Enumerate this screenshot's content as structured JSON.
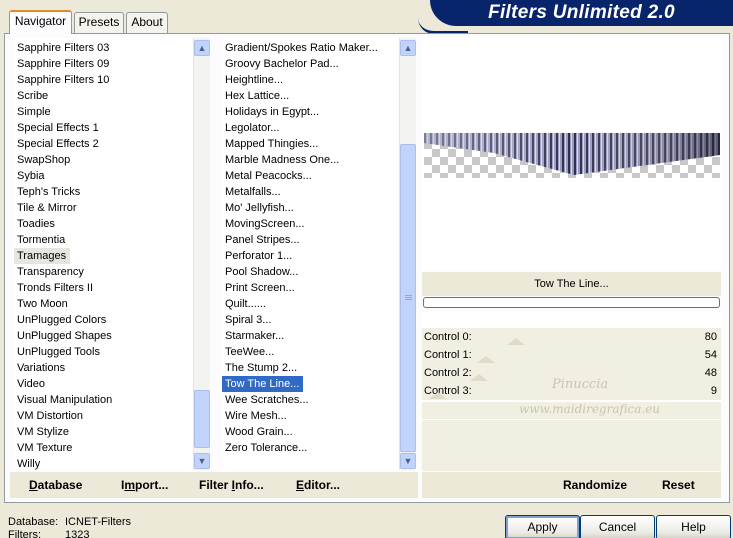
{
  "window": {
    "banner_title": "Filters Unlimited 2.0"
  },
  "tabs": [
    {
      "label": "Navigator",
      "active": true
    },
    {
      "label": "Presets",
      "active": false
    },
    {
      "label": "About",
      "active": false
    }
  ],
  "categories": {
    "items": [
      "Sapphire Filters 03",
      "Sapphire Filters 09",
      "Sapphire Filters 10",
      "Scribe",
      "Simple",
      "Special Effects 1",
      "Special Effects 2",
      "SwapShop",
      "Sybia",
      "Teph's Tricks",
      "Tile & Mirror",
      "Toadies",
      "Tormentia",
      "Tramages",
      "Transparency",
      "Tronds Filters II",
      "Two Moon",
      "UnPlugged Colors",
      "UnPlugged Shapes",
      "UnPlugged Tools",
      "Variations",
      "Video",
      "Visual Manipulation",
      "VM Distortion",
      "VM Stylize",
      "VM Texture",
      "Willy"
    ],
    "selected": "Tramages"
  },
  "filters": {
    "items": [
      "Gradient/Spokes Ratio Maker...",
      "Groovy Bachelor Pad...",
      "Heightline...",
      "Hex Lattice...",
      "Holidays in Egypt...",
      "Legolator...",
      "Mapped Thingies...",
      "Marble Madness One...",
      "Metal Peacocks...",
      "Metalfalls...",
      "Mo' Jellyfish...",
      "MovingScreen...",
      "Panel Stripes...",
      "Perforator 1...",
      "Pool Shadow...",
      "Print Screen...",
      "Quilt......",
      "Spiral 3...",
      "Starmaker...",
      "TeeWee...",
      "The Stump 2...",
      "Tow The Line...",
      "Wee Scratches...",
      "Wire Mesh...",
      "Wood Grain...",
      "Zero Tolerance..."
    ],
    "selected": "Tow The Line..."
  },
  "preview": {
    "filter_name": "Tow The Line..."
  },
  "controls": [
    {
      "label": "Control 0:",
      "value": "80"
    },
    {
      "label": "Control 1:",
      "value": "54"
    },
    {
      "label": "Control 2:",
      "value": "48"
    },
    {
      "label": "Control 3:",
      "value": "9"
    }
  ],
  "watermark": {
    "line1": "Pinuccia",
    "line2": "www.maidiregrafica.eu"
  },
  "toolbar": {
    "database": {
      "u": "D",
      "rest": "atabase"
    },
    "import": {
      "pre": "I",
      "u": "m",
      "rest": "port..."
    },
    "filter_info": {
      "pre": "Filter ",
      "u": "I",
      "rest": "nfo..."
    },
    "editor": {
      "u": "E",
      "rest": "ditor..."
    },
    "randomize": "Randomize",
    "reset": "Reset"
  },
  "buttons": {
    "apply": "Apply",
    "cancel": "Cancel",
    "help": "Help"
  },
  "status": {
    "database_label": "Database:",
    "database_value": "ICNET-Filters",
    "filters_label": "Filters:",
    "filters_value": "1323"
  },
  "colors": {
    "banner": "#08246b",
    "selection": "#316ac5",
    "scroll_thumb": "#c1d3fb",
    "tab_accent": "#e68b2c"
  }
}
